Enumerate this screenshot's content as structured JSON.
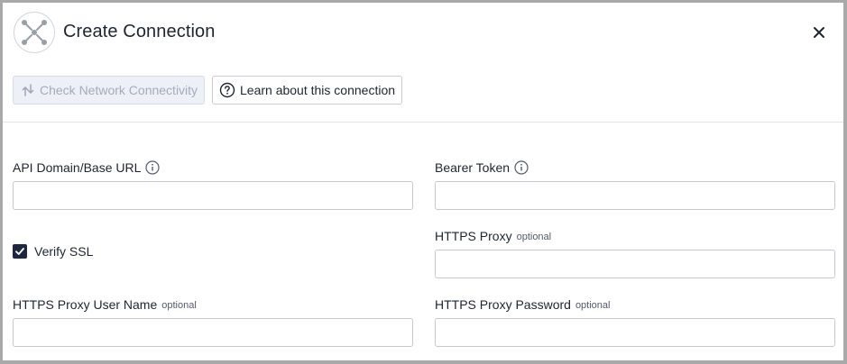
{
  "dialog": {
    "title": "Create Connection",
    "logo_icon": "connector-logo-icon",
    "close_icon": "close-icon"
  },
  "toolbar": {
    "check_connectivity_label": "Check Network Connectivity",
    "check_connectivity_icon": "network-check-icon",
    "check_connectivity_disabled": true,
    "learn_label": "Learn about this connection",
    "learn_icon": "help-circle-icon"
  },
  "form": {
    "api_domain": {
      "label": "API Domain/Base URL",
      "value": "",
      "info_icon": "info-icon"
    },
    "bearer_token": {
      "label": "Bearer Token",
      "value": "",
      "info_icon": "info-icon"
    },
    "verify_ssl": {
      "label": "Verify SSL",
      "checked": true
    },
    "https_proxy": {
      "label": "HTTPS Proxy",
      "optional_text": "optional",
      "value": ""
    },
    "https_proxy_user": {
      "label": "HTTPS Proxy User Name",
      "optional_text": "optional",
      "value": ""
    },
    "https_proxy_password": {
      "label": "HTTPS Proxy Password",
      "optional_text": "optional",
      "value": ""
    }
  },
  "colors": {
    "checkbox": "#1f2740",
    "disabled_button_bg": "#eef0f8",
    "border": "#c4c8d0"
  }
}
